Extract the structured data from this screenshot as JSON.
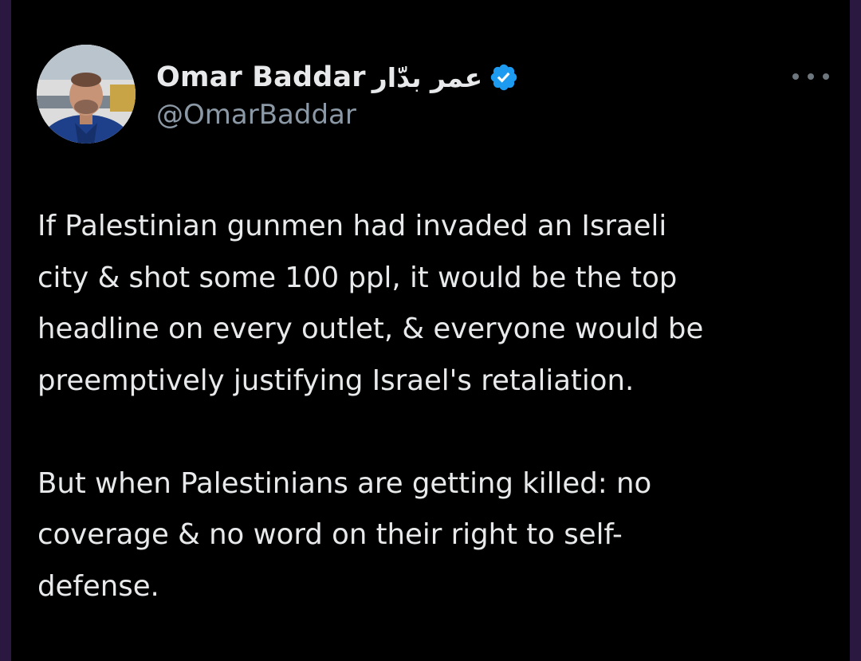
{
  "author": {
    "display_name": "Omar Baddar",
    "arabic_name": "عمر بدّار",
    "handle": "@OmarBaddar",
    "verified_icon": "verified-badge-icon"
  },
  "menu_icon": "more-options-icon",
  "tweet": {
    "paragraph_1": "If Palestinian gunmen had invaded an Israeli\ncity & shot some 100 ppl, it would be the top\nheadline on every outlet, & everyone would be\npreemptively justifying Israel's retaliation.",
    "paragraph_2": "But when Palestinians are getting killed: no\ncoverage & no word on their right to self-\ndefense."
  },
  "colors": {
    "background": "#000000",
    "text": "#e7e9ea",
    "muted": "#8b98a5",
    "verified": "#1d9bf0",
    "outer": "#2a1840"
  }
}
